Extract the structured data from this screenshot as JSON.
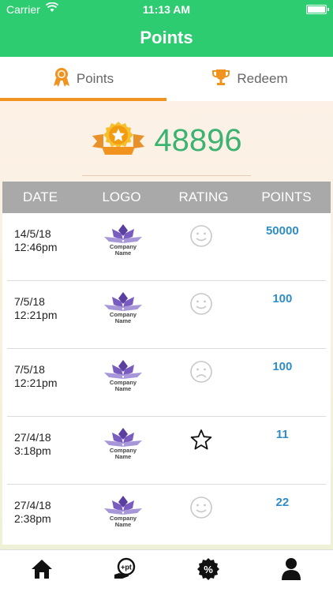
{
  "status": {
    "carrier": "Carrier",
    "time": "11:13 AM"
  },
  "nav": {
    "title": "Points"
  },
  "tabs": [
    {
      "label": "Points",
      "icon": "medal-icon",
      "active": true
    },
    {
      "label": "Redeem",
      "icon": "trophy-icon",
      "active": false
    }
  ],
  "summary": {
    "total_points": "48896",
    "icon": "star-coin-icon"
  },
  "table": {
    "headers": {
      "date": "DATE",
      "logo": "LOGO",
      "rating": "RATING",
      "points": "POINTS"
    },
    "rows": [
      {
        "date": "14/5/18",
        "time": "12:46pm",
        "logo_line1": "Company",
        "logo_line2": "Name",
        "rating": "smile-face",
        "points": "50000"
      },
      {
        "date": "7/5/18",
        "time": "12:21pm",
        "logo_line1": "Company",
        "logo_line2": "Name",
        "rating": "smile-face",
        "points": "100"
      },
      {
        "date": "7/5/18",
        "time": "12:21pm",
        "logo_line1": "Company",
        "logo_line2": "Name",
        "rating": "sad-face",
        "points": "100"
      },
      {
        "date": "27/4/18",
        "time": "3:18pm",
        "logo_line1": "Company",
        "logo_line2": "Name",
        "rating": "star-outline",
        "points": "11"
      },
      {
        "date": "27/4/18",
        "time": "2:38pm",
        "logo_line1": "Company",
        "logo_line2": "Name",
        "rating": "smile-face",
        "points": "22"
      }
    ]
  },
  "bottom_bar": [
    {
      "icon": "home-icon"
    },
    {
      "icon": "add-points-icon"
    },
    {
      "icon": "discount-badge-icon"
    },
    {
      "icon": "profile-icon"
    }
  ],
  "colors": {
    "header_green": "#2ecc71",
    "accent_orange": "#f0931f",
    "points_green": "#3cb371",
    "points_blue": "#2f8cc7",
    "table_header_gray": "#a9a9a9"
  }
}
